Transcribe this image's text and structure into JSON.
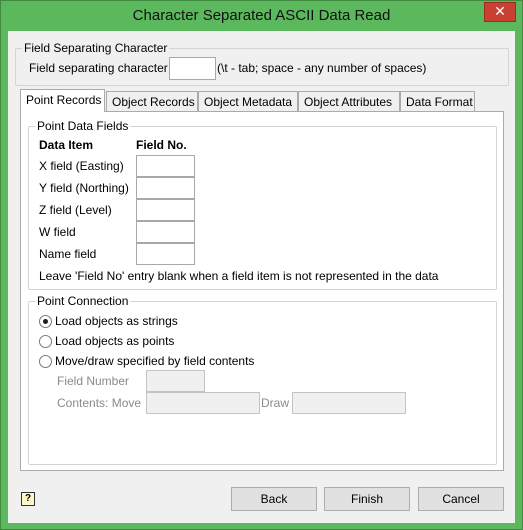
{
  "window": {
    "title": "Character Separated ASCII Data Read",
    "close_symbol": "✕"
  },
  "separator": {
    "group_label": "Field Separating Character",
    "field_label": "Field separating character",
    "field_value": "",
    "hint": "(\\t - tab; space - any number of spaces)"
  },
  "tabs": [
    {
      "label": "Point Records",
      "active": true
    },
    {
      "label": "Object Records",
      "active": false
    },
    {
      "label": "Object Metadata",
      "active": false
    },
    {
      "label": "Object Attributes",
      "active": false
    },
    {
      "label": "Data Format",
      "active": false
    }
  ],
  "point_fields": {
    "group_label": "Point Data Fields",
    "col_data_item": "Data Item",
    "col_field_no": "Field No.",
    "rows": [
      {
        "label": "X field (Easting)",
        "value": ""
      },
      {
        "label": "Y field (Northing)",
        "value": ""
      },
      {
        "label": "Z field (Level)",
        "value": ""
      },
      {
        "label": "W field",
        "value": ""
      },
      {
        "label": "Name field",
        "value": ""
      }
    ],
    "note": "Leave 'Field No' entry blank when a field item is not represented in the data"
  },
  "connection": {
    "group_label": "Point Connection",
    "options": [
      {
        "label": "Load objects as strings",
        "selected": true
      },
      {
        "label": "Load objects as points",
        "selected": false
      },
      {
        "label": "Move/draw specified by field contents",
        "selected": false
      }
    ],
    "field_number_label": "Field Number",
    "contents_move_label": "Contents: Move",
    "draw_label": "Draw"
  },
  "footer": {
    "help_icon": "help-icon",
    "help_glyph": "?",
    "back_label": "Back",
    "finish_label": "Finish",
    "cancel_label": "Cancel"
  },
  "colors": {
    "titlebar": "#5cb85c",
    "close_button": "#c84031",
    "dialog_bg": "#f0f0f0"
  }
}
